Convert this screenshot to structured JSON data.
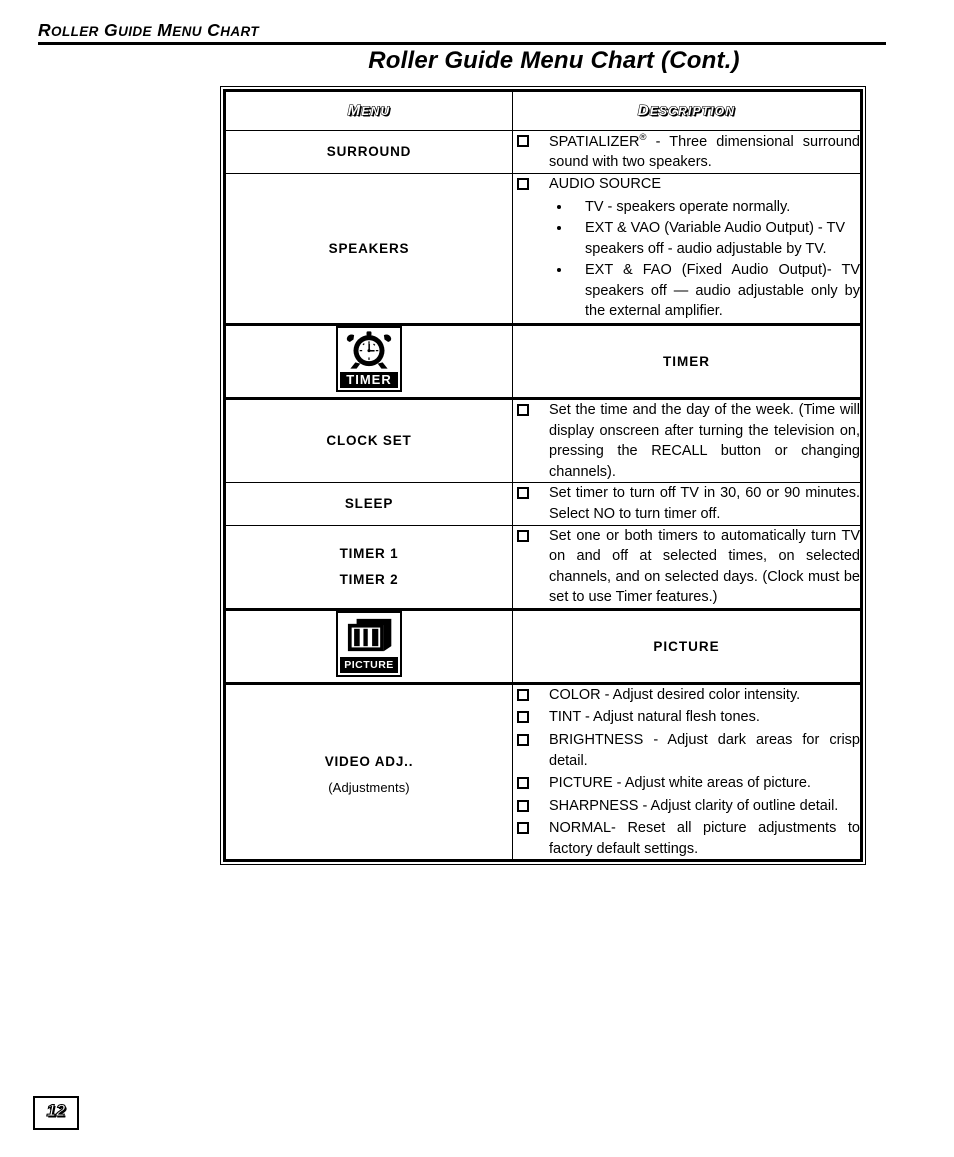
{
  "running_header": "ROLLER GUIDE MENU CHART",
  "page_title": "Roller Guide Menu Chart (Cont.)",
  "page_number": "12",
  "table": {
    "headers": {
      "menu": "MENU",
      "description": "DESCRIPTION"
    },
    "rows": [
      {
        "kind": "entry",
        "menu": "SURROUND",
        "items": [
          {
            "marker": "square",
            "text_before": "SPATIALIZER",
            "superscript": "®",
            "text_after": " - Three dimensional surround sound with two speakers."
          }
        ]
      },
      {
        "kind": "entry",
        "menu": "SPEAKERS",
        "items": [
          {
            "marker": "square",
            "text": "AUDIO SOURCE",
            "subitems": [
              "TV - speakers operate normally.",
              "EXT & VAO (Variable Audio Output) - TV speakers off - audio adjustable by TV.",
              "EXT & FAO (Fixed Audio Output)- TV speakers off — audio adjustable only by the external amplifier."
            ]
          }
        ]
      },
      {
        "kind": "banner",
        "icon_name": "timer-icon",
        "icon_word": "TIMER",
        "banner_label": "TIMER"
      },
      {
        "kind": "entry",
        "menu": "CLOCK SET",
        "items": [
          {
            "marker": "square",
            "text": "Set the time and the day of the week. (Time will display onscreen after turning the television on, pressing the RECALL button or changing channels)."
          }
        ]
      },
      {
        "kind": "entry",
        "menu": "SLEEP",
        "items": [
          {
            "marker": "square",
            "text": "Set timer to turn off TV in 30, 60 or 90 minutes.  Select NO to turn timer off."
          }
        ]
      },
      {
        "kind": "entry",
        "menu": "TIMER 1",
        "menu_line2": "TIMER 2",
        "items": [
          {
            "marker": "square",
            "text": "Set one or both timers to automatically turn TV on and off at selected times, on selected channels, and on selected days. (Clock must be set to use Timer features.)"
          }
        ]
      },
      {
        "kind": "banner",
        "icon_name": "picture-icon",
        "icon_word": "PICTURE",
        "banner_label": "PICTURE"
      },
      {
        "kind": "entry",
        "menu": "VIDEO ADJ..",
        "menu_sub": "(Adjustments)",
        "items": [
          {
            "marker": "square",
            "text": "COLOR - Adjust desired color intensity."
          },
          {
            "marker": "square",
            "text": "TINT - Adjust natural flesh tones."
          },
          {
            "marker": "square",
            "text": "BRIGHTNESS - Adjust dark areas for crisp detail."
          },
          {
            "marker": "square",
            "text": "PICTURE - Adjust white areas of picture."
          },
          {
            "marker": "square",
            "text": "SHARPNESS - Adjust clarity of outline detail."
          },
          {
            "marker": "square",
            "text": "NORMAL- Reset all picture adjustments to factory default settings."
          }
        ]
      }
    ]
  },
  "colors": {
    "ink": "#000000",
    "paper": "#ffffff",
    "faint_rule": "#9a9a9a"
  }
}
